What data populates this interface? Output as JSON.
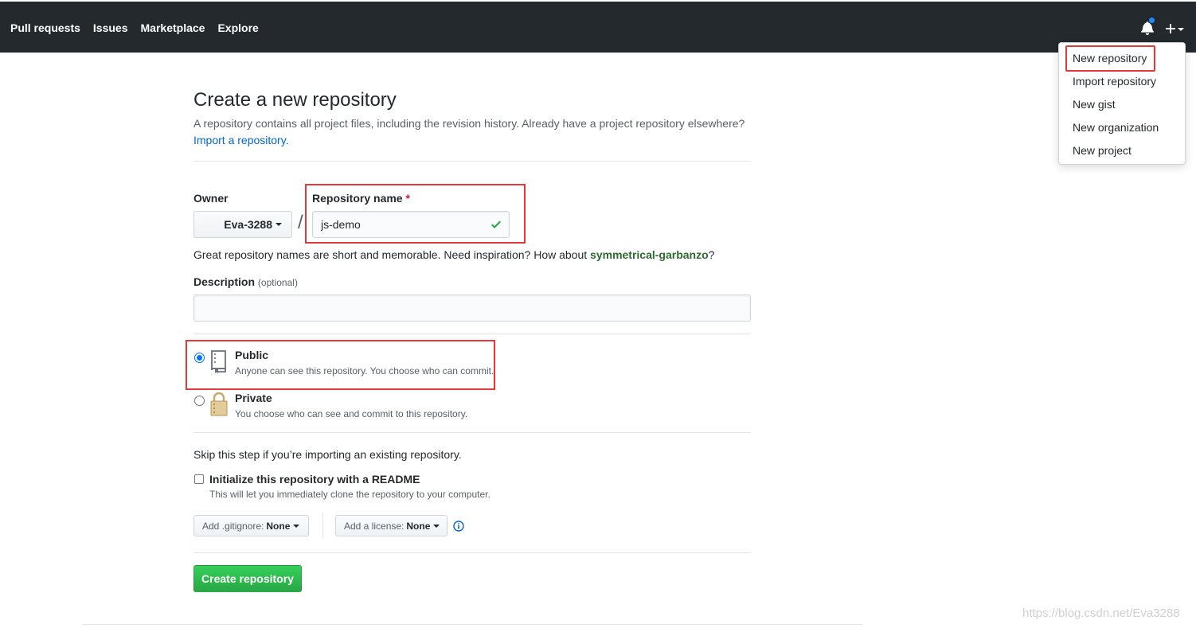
{
  "header": {
    "nav": [
      "Pull requests",
      "Issues",
      "Marketplace",
      "Explore"
    ],
    "bg_color": "#24292e"
  },
  "create_menu": {
    "items": [
      "New repository",
      "Import repository",
      "New gist",
      "New organization",
      "New project"
    ]
  },
  "page": {
    "title": "Create a new repository",
    "subtitle": "A repository contains all project files, including the revision history. Already have a project repository elsewhere?",
    "import_link": "Import a repository.",
    "owner_label": "Owner",
    "owner_value": "Eva-3288",
    "slash": "/",
    "repo_name_label": "Repository name",
    "required_mark": "*",
    "repo_name_value": "js-demo",
    "hint_prefix": "Great repository names are short and memorable. Need inspiration? How about",
    "hint_suggestion": "symmetrical-garbanzo",
    "hint_suffix": "?",
    "description_label": "Description",
    "description_optional": "(optional)",
    "description_value": "",
    "public_title": "Public",
    "public_desc": "Anyone can see this repository. You choose who can commit.",
    "private_title": "Private",
    "private_desc": "You choose who can see and commit to this repository.",
    "skip_text": "Skip this step if you’re importing an existing repository.",
    "init_label": "Initialize this repository with a README",
    "init_desc": "This will let you immediately clone the repository to your computer.",
    "gitignore_label": "Add .gitignore:",
    "gitignore_value": "None",
    "license_label": "Add a license:",
    "license_value": "None",
    "create_button": "Create repository"
  },
  "watermark": "https://blog.csdn.net/Eva3288",
  "colors": {
    "accent": "#0366d6",
    "success": "#28a745",
    "highlight": "#e03a3a"
  }
}
